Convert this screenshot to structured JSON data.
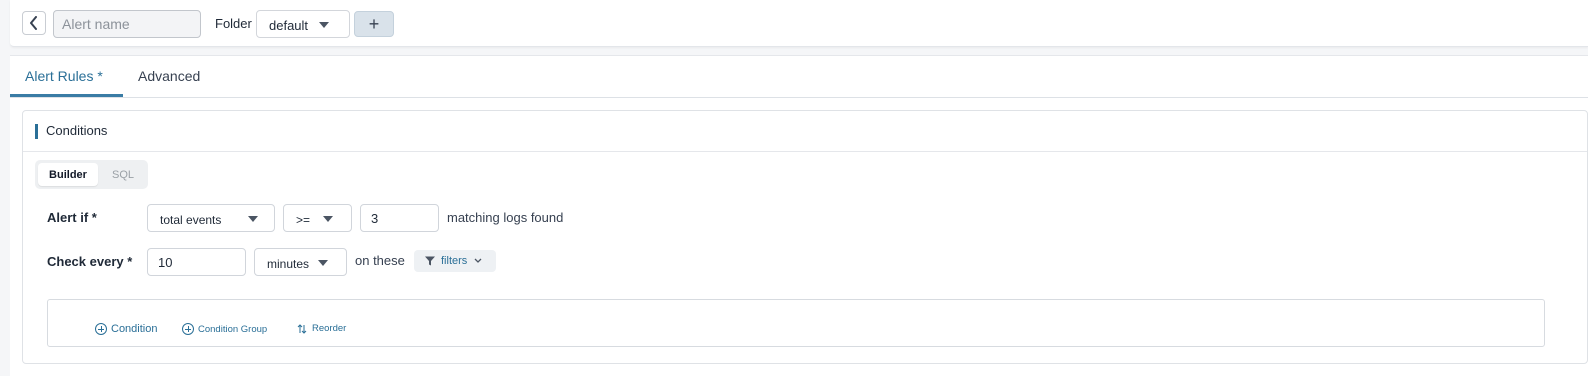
{
  "header": {
    "alert_name_placeholder": "Alert name",
    "alert_name_value": "",
    "folder_label": "Folder",
    "folder_value": "default",
    "add_folder_label": "+"
  },
  "tabs": [
    {
      "label": "Alert Rules *",
      "active": true
    },
    {
      "label": "Advanced",
      "active": false
    }
  ],
  "conditions": {
    "title": "Conditions",
    "mode_toggle": {
      "builder": "Builder",
      "sql": "SQL",
      "selected": "Builder"
    },
    "alert_if": {
      "label": "Alert if *",
      "metric": "total events",
      "operator": ">=",
      "threshold": "3",
      "suffix": "matching logs found"
    },
    "check_every": {
      "label": "Check every *",
      "value": "10",
      "unit": "minutes",
      "suffix": "on these",
      "filters_label": "filters"
    },
    "actions": {
      "add_condition": "Condition",
      "add_condition_group": "Condition Group",
      "reorder": "Reorder"
    }
  },
  "colors": {
    "accent": "#2a6f97",
    "tab_underline": "#3a7ca5",
    "add_button_bg": "#d9e2ea"
  }
}
